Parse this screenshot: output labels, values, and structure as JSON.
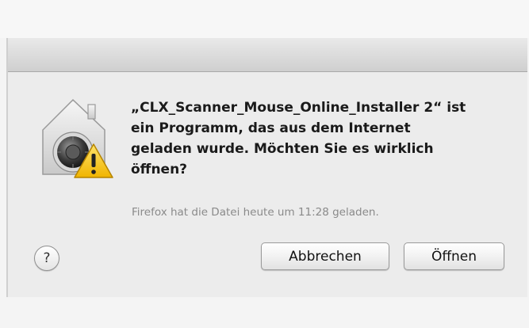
{
  "dialog": {
    "message": "„CLX_Scanner_Mouse_Online_Installer 2“ ist\nein Programm, das aus dem Internet\ngeladen wurde. Möchten Sie es wirklich\nöffnen?",
    "subtext": "Firefox hat die Datei heute um 11:28 geladen.",
    "help_label": "?",
    "cancel_label": "Abbrechen",
    "open_label": "Öffnen",
    "icon": "gatekeeper-warning-icon"
  }
}
